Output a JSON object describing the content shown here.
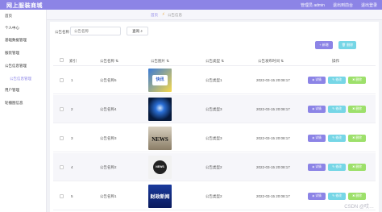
{
  "app": {
    "title": "网上服装商城",
    "user_label": "管理员 admin",
    "logout_label": "退出到前台",
    "exit_label": "退出登录"
  },
  "sidebar": {
    "items": [
      {
        "label": "首页"
      },
      {
        "label": "个人中心"
      },
      {
        "label": "基础数据管理"
      },
      {
        "label": "服装管理"
      },
      {
        "label": "公告信息管理"
      },
      {
        "label": "公告信息管理"
      },
      {
        "label": "用户管理"
      },
      {
        "label": "轮播图信息"
      }
    ]
  },
  "breadcrumb": {
    "home": "首页",
    "current": "公告信息"
  },
  "search": {
    "label": "公告名称",
    "placeholder": "公告名称",
    "button": "查询"
  },
  "toolbar": {
    "add_label": "+ 新增",
    "delete_label": "🗑 删除"
  },
  "table": {
    "headers": {
      "index": "索引",
      "name": "公告名称",
      "image": "公告图片",
      "type": "公告类型",
      "time": "公告发布时间",
      "action": "操作"
    },
    "rows": [
      {
        "index": "1",
        "name": "公告名称5",
        "type": "公告类型1",
        "time": "2022-03-15 20:08:17",
        "thumb_text": "快讯"
      },
      {
        "index": "2",
        "name": "公告名称4",
        "type": "公告类型3",
        "time": "2022-03-15 20:08:17",
        "thumb_text": ""
      },
      {
        "index": "3",
        "name": "公告名称3",
        "type": "公告类型3",
        "time": "2022-03-15 20:08:17",
        "thumb_text": "NEWS"
      },
      {
        "index": "4",
        "name": "公告名称2",
        "type": "公告类型2",
        "time": "2022-03-15 20:08:17",
        "thumb_text": "NEWS"
      },
      {
        "index": "5",
        "name": "公告名称1",
        "type": "公告类型2",
        "time": "2022-03-15 20:08:17",
        "thumb_text": "财政新闻"
      }
    ],
    "actions": {
      "detail": "详情",
      "edit": "修改",
      "remove": "删除"
    }
  },
  "watermark": "CSDN @哎…"
}
